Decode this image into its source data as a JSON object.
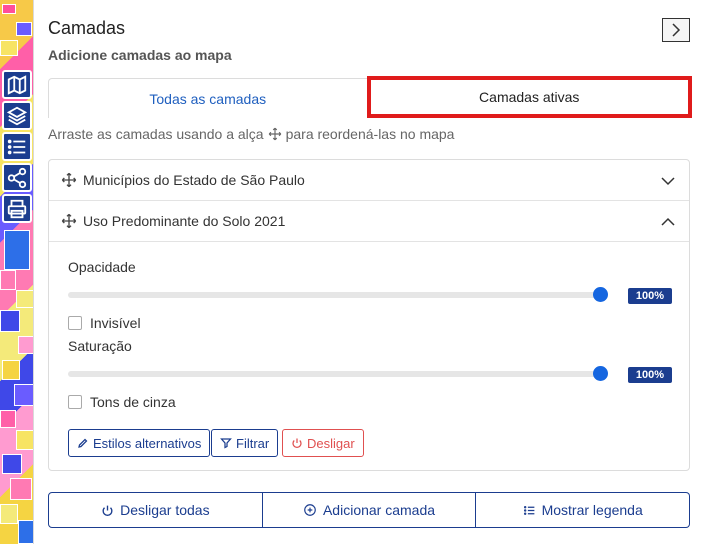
{
  "panel": {
    "title": "Camadas",
    "subtitle": "Adicione camadas ao mapa"
  },
  "tabs": [
    {
      "label": "Todas as camadas",
      "active": false
    },
    {
      "label": "Camadas ativas",
      "active": true
    }
  ],
  "hint": {
    "before": "Arraste as camadas usando a alça",
    "after": "para reordená-las no mapa"
  },
  "layers": [
    {
      "name": "Municípios do Estado de São Paulo",
      "expanded": false
    },
    {
      "name": "Uso Predominante do Solo 2021",
      "expanded": true
    }
  ],
  "layer_settings": {
    "opacity_label": "Opacidade",
    "opacity_value": "100%",
    "opacity_level": 1.0,
    "invisible_label": "Invisível",
    "invisible_checked": false,
    "saturation_label": "Saturação",
    "saturation_value": "100%",
    "saturation_level": 1.0,
    "grayscale_label": "Tons de cinza",
    "grayscale_checked": false
  },
  "layer_actions": {
    "styles_label": "Estilos alternativos",
    "filter_label": "Filtrar",
    "disable_label": "Desligar"
  },
  "footer": {
    "disable_all_label": "Desligar todas",
    "add_layer_label": "Adicionar camada",
    "show_legend_label": "Mostrar legenda"
  },
  "colors": {
    "accent": "#1b3d8f",
    "link": "#1f5fbf",
    "slider": "#1566e0",
    "danger": "#e05050",
    "highlight": "#e01b1b"
  }
}
